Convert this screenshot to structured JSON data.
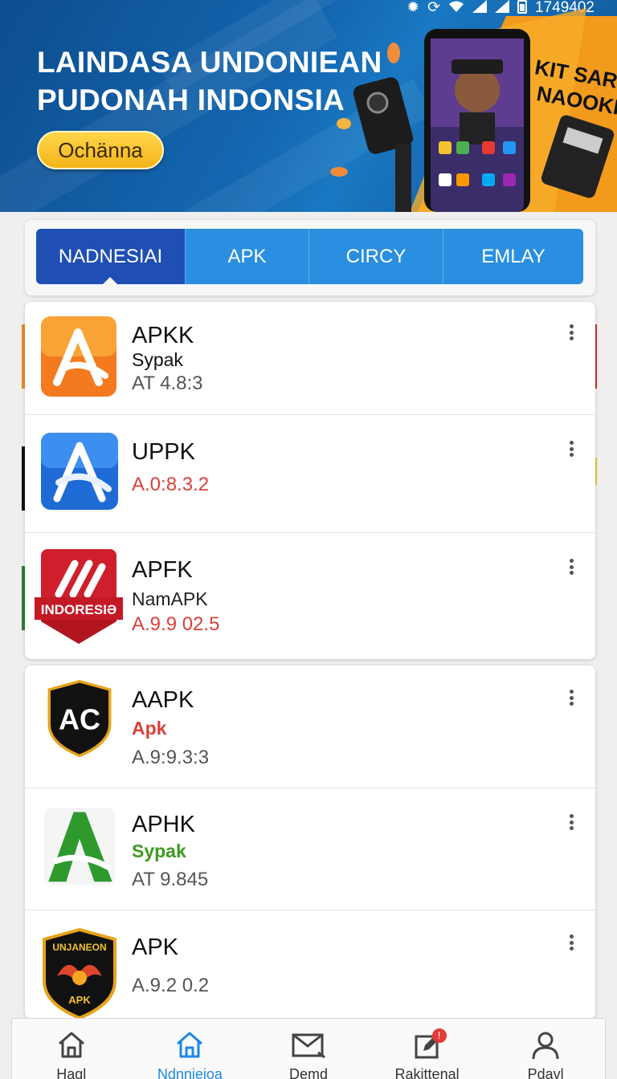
{
  "status_bar": {
    "time": "1749402"
  },
  "banner": {
    "title_line1": "LAINDASA UNDONIEAN",
    "title_line2": "PUDONAH INDONSIA",
    "cta_label": "Ochänna",
    "promo_text": "KIT SARR NAOOKI"
  },
  "tabs": [
    {
      "label": "NADNESIAI",
      "active": true
    },
    {
      "label": "APK",
      "active": false
    },
    {
      "label": "CIRCY",
      "active": false
    },
    {
      "label": "EMLAY",
      "active": false
    }
  ],
  "apps": [
    {
      "name": "APKK",
      "subtitle": "Sypak",
      "version": "AT 4.8:3",
      "icon": "orange-a-app-icon"
    },
    {
      "name": "UPPK",
      "subtitle": "",
      "version": "A.0:8.3.2",
      "icon": "blue-a-app-icon"
    },
    {
      "name": "APFK",
      "subtitle": "NamAPK",
      "version": "A.9.9 02.5",
      "icon": "red-indonesia-app-icon",
      "icon_text": "INDORESIƏ"
    },
    {
      "name": "AAPK",
      "subtitle": "Apk",
      "version": "A.9:9.3:3",
      "icon": "ac-shield-app-icon",
      "icon_text": "AC"
    },
    {
      "name": "APHK",
      "subtitle": "Sypak",
      "version": "AT 9.845",
      "icon": "green-a-app-icon"
    },
    {
      "name": "APK",
      "subtitle": "",
      "version": "A.9.2 0.2",
      "icon": "unjaneon-badge-app-icon",
      "icon_text": "UNJANEON",
      "icon_text2": "APK"
    }
  ],
  "colors": {
    "tab_active": "#1f4fb4",
    "tab": "#2a8fe0",
    "version_red": "#d9413a",
    "subtitle_red": "#d9413a",
    "subtitle_green": "#3d9a22"
  },
  "bottom_nav": [
    {
      "label": "Hagl",
      "icon": "home-icon",
      "active": false
    },
    {
      "label": "Ndnnieioa",
      "icon": "home-icon",
      "active": true
    },
    {
      "label": "Demd",
      "icon": "mail-icon",
      "active": false
    },
    {
      "label": "Rakittenal",
      "icon": "edit-icon",
      "active": false,
      "badge": "!"
    },
    {
      "label": "Pdavl",
      "icon": "person-icon",
      "active": false
    }
  ]
}
